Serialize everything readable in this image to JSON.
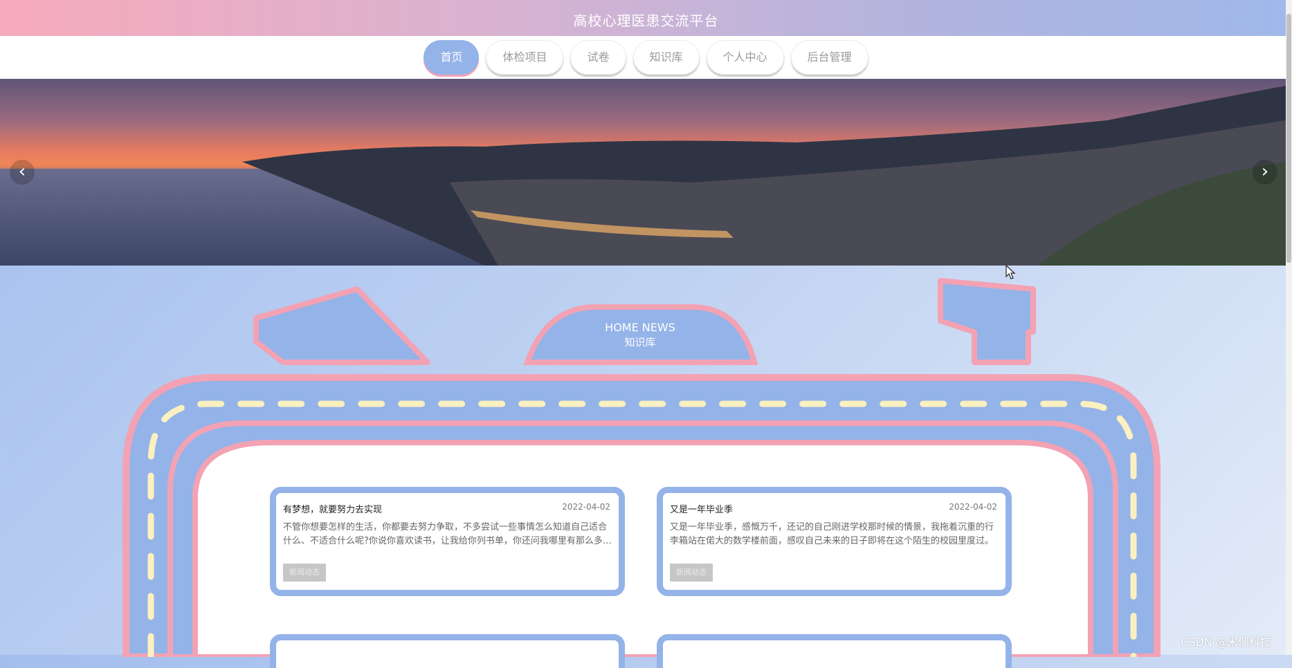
{
  "header": {
    "title": "高校心理医患交流平台"
  },
  "nav": {
    "items": [
      {
        "label": "首页",
        "active": true
      },
      {
        "label": "体检项目",
        "active": false
      },
      {
        "label": "试卷",
        "active": false
      },
      {
        "label": "知识库",
        "active": false
      },
      {
        "label": "个人中心",
        "active": false
      },
      {
        "label": "后台管理",
        "active": false
      }
    ]
  },
  "banner": {
    "prev_icon": "chevron-left-icon",
    "next_icon": "chevron-right-icon",
    "prev_glyph": "‹",
    "next_glyph": "›"
  },
  "section": {
    "title_en": "HOME NEWS",
    "title_cn": "知识库"
  },
  "news": [
    {
      "title": "有梦想，就要努力去实现",
      "date": "2022-04-02",
      "desc": "不管你想要怎样的生活，你都要去努力争取，不多尝试一些事情怎么知道自己适合什么、不适合什么呢?你说你喜欢读书，让我给你列书单，你还问我哪里有那么多时间读书。",
      "tag": "新闻动态"
    },
    {
      "title": "又是一年毕业季",
      "date": "2022-04-02",
      "desc": "又是一年毕业季，感慨万千，还记的自己刚进学校那时候的情景，我拖着沉重的行李箱站在偌大的数学楼前面，感叹自己未来的日子即将在这个陌生的校园里度过。",
      "tag": "新闻动态"
    }
  ],
  "watermark": "CSDN @米偶科技",
  "colors": {
    "accent_blue": "#94b3e8",
    "accent_pink": "#f3a2b4",
    "dash_yellow": "#faf0c0"
  }
}
